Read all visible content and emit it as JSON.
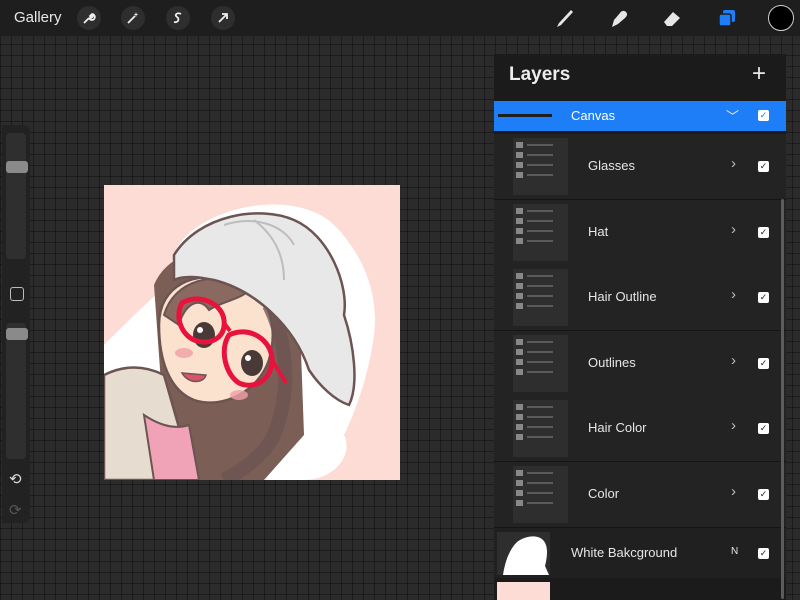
{
  "topbar": {
    "gallery_label": "Gallery",
    "tools": [
      "wrench-icon",
      "magic-wand-icon",
      "selection-icon",
      "transform-icon",
      "brush-icon",
      "smudge-icon",
      "eraser-icon",
      "layers-icon"
    ],
    "active_tool": "layers-icon",
    "color_value": "#000000"
  },
  "sidebar": {
    "size_slider_value": 0.14,
    "opacity_slider_value": 0.04
  },
  "layers": {
    "title": "Layers",
    "canvas_row": {
      "label": "Canvas",
      "checked": true
    },
    "groups": [
      {
        "label": "Glasses",
        "checked": true
      },
      {
        "label": "Hat",
        "checked": true
      },
      {
        "label": "Hair Outline",
        "checked": true
      },
      {
        "label": "Outlines",
        "checked": true
      },
      {
        "label": "Hair Color",
        "checked": true
      },
      {
        "label": "Color",
        "checked": true
      }
    ],
    "white_background": {
      "label": "White Bakcground",
      "blend_mode": "N",
      "checked": true
    }
  },
  "colors": {
    "accent": "#1e7ef8",
    "canvas_bg": "#fcdcd5",
    "glasses": "#e8123c"
  }
}
